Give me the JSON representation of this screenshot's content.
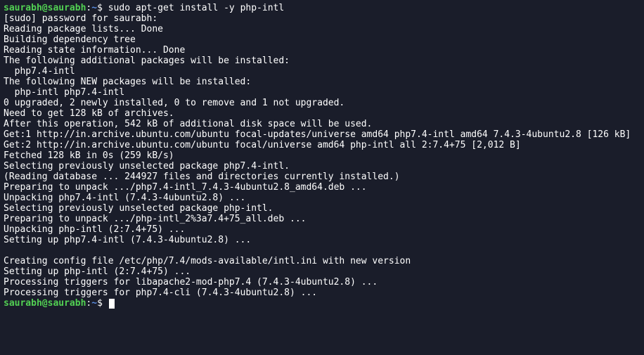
{
  "prompt1": {
    "user": "saurabh",
    "at": "@",
    "host": "saurabh",
    "colon": ":",
    "path": "~",
    "dollar": "$ ",
    "command": "sudo apt-get install -y php-intl"
  },
  "output": [
    "[sudo] password for saurabh:",
    "Reading package lists... Done",
    "Building dependency tree",
    "Reading state information... Done",
    "The following additional packages will be installed:",
    "  php7.4-intl",
    "The following NEW packages will be installed:",
    "  php-intl php7.4-intl",
    "0 upgraded, 2 newly installed, 0 to remove and 1 not upgraded.",
    "Need to get 128 kB of archives.",
    "After this operation, 542 kB of additional disk space will be used.",
    "Get:1 http://in.archive.ubuntu.com/ubuntu focal-updates/universe amd64 php7.4-intl amd64 7.4.3-4ubuntu2.8 [126 kB]",
    "Get:2 http://in.archive.ubuntu.com/ubuntu focal/universe amd64 php-intl all 2:7.4+75 [2,012 B]",
    "Fetched 128 kB in 0s (259 kB/s)",
    "Selecting previously unselected package php7.4-intl.",
    "(Reading database ... 244927 files and directories currently installed.)",
    "Preparing to unpack .../php7.4-intl_7.4.3-4ubuntu2.8_amd64.deb ...",
    "Unpacking php7.4-intl (7.4.3-4ubuntu2.8) ...",
    "Selecting previously unselected package php-intl.",
    "Preparing to unpack .../php-intl_2%3a7.4+75_all.deb ...",
    "Unpacking php-intl (2:7.4+75) ...",
    "Setting up php7.4-intl (7.4.3-4ubuntu2.8) ...",
    "",
    "Creating config file /etc/php/7.4/mods-available/intl.ini with new version",
    "Setting up php-intl (2:7.4+75) ...",
    "Processing triggers for libapache2-mod-php7.4 (7.4.3-4ubuntu2.8) ...",
    "Processing triggers for php7.4-cli (7.4.3-4ubuntu2.8) ..."
  ],
  "prompt2": {
    "user": "saurabh",
    "at": "@",
    "host": "saurabh",
    "colon": ":",
    "path": "~",
    "dollar": "$ "
  }
}
